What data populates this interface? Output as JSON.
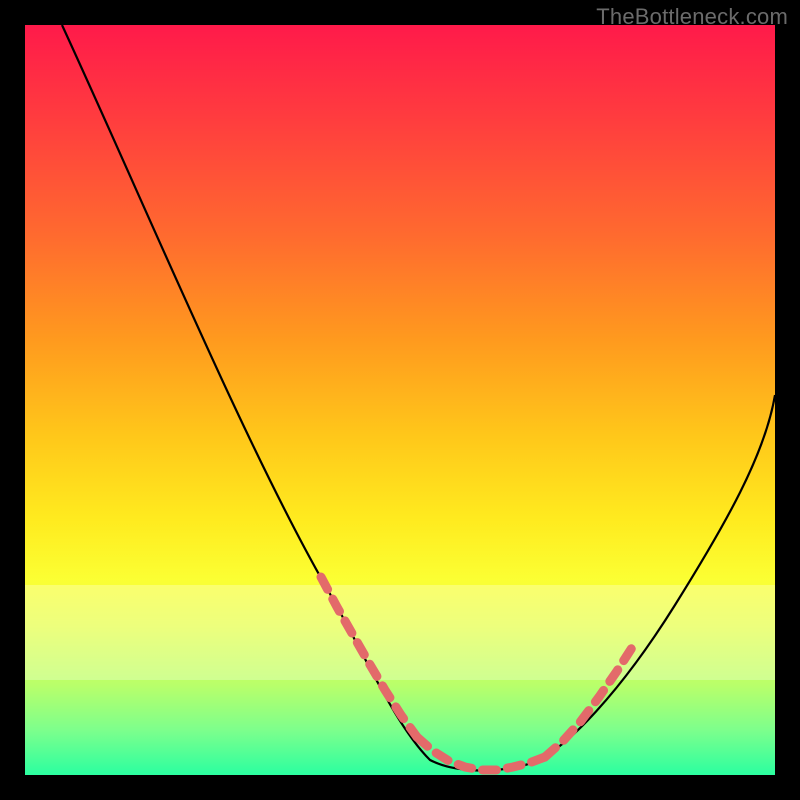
{
  "watermark": "TheBottleneck.com",
  "chart_data": {
    "type": "line",
    "title": "",
    "xlabel": "",
    "ylabel": "",
    "xlim": [
      0,
      100
    ],
    "ylim": [
      0,
      100
    ],
    "grid": false,
    "legend": false,
    "series": [
      {
        "name": "bottleneck-curve",
        "x": [
          5,
          10,
          15,
          20,
          25,
          30,
          35,
          40,
          45,
          48,
          50,
          53,
          55,
          58,
          60,
          63,
          65,
          70,
          75,
          80,
          85,
          90,
          95,
          100
        ],
        "y": [
          100,
          89,
          78,
          67,
          56,
          45,
          34,
          24,
          14,
          8,
          5,
          2,
          1,
          1,
          1,
          1,
          2,
          4,
          8,
          15,
          23,
          32,
          41,
          51
        ],
        "color": "#000000"
      },
      {
        "name": "highlight-left",
        "x": [
          40,
          42,
          44,
          46,
          48,
          50
        ],
        "y": [
          24,
          20,
          16,
          12,
          8,
          5
        ],
        "color": "#e86a6a",
        "style": "dashed"
      },
      {
        "name": "highlight-bottom",
        "x": [
          50,
          53,
          55,
          58,
          60,
          62,
          64,
          66,
          68,
          70
        ],
        "y": [
          5,
          2,
          1,
          1,
          1,
          1,
          1,
          2,
          3,
          4
        ],
        "color": "#e86a6a",
        "style": "dashed"
      },
      {
        "name": "highlight-right",
        "x": [
          70,
          73,
          76,
          79,
          82
        ],
        "y": [
          4,
          7,
          10,
          14,
          18
        ],
        "color": "#e86a6a",
        "style": "dashed"
      }
    ],
    "annotations": [
      {
        "text": "TheBottleneck.com",
        "position": "top-right"
      }
    ]
  }
}
